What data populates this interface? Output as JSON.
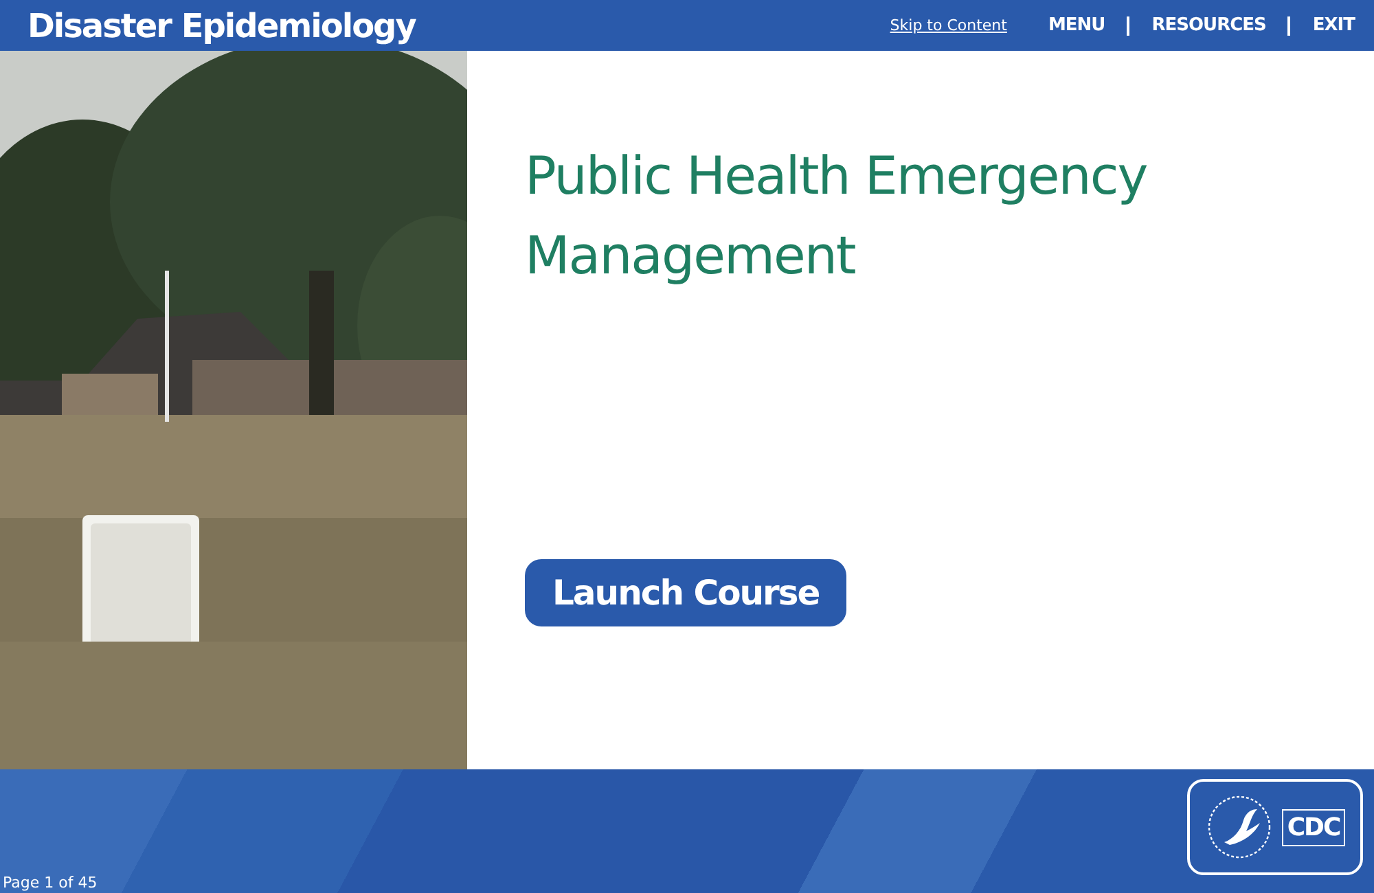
{
  "header": {
    "title": "Disaster Epidemiology",
    "skip_link": "Skip to Content",
    "nav": [
      "MENU",
      "RESOURCES",
      "EXIT"
    ]
  },
  "hero": {
    "course_title": "Public Health Emergency Management",
    "launch_button": "Launch Course"
  },
  "footer": {
    "page_indicator": "Page 1 of 45",
    "logo_text": "CDC"
  }
}
